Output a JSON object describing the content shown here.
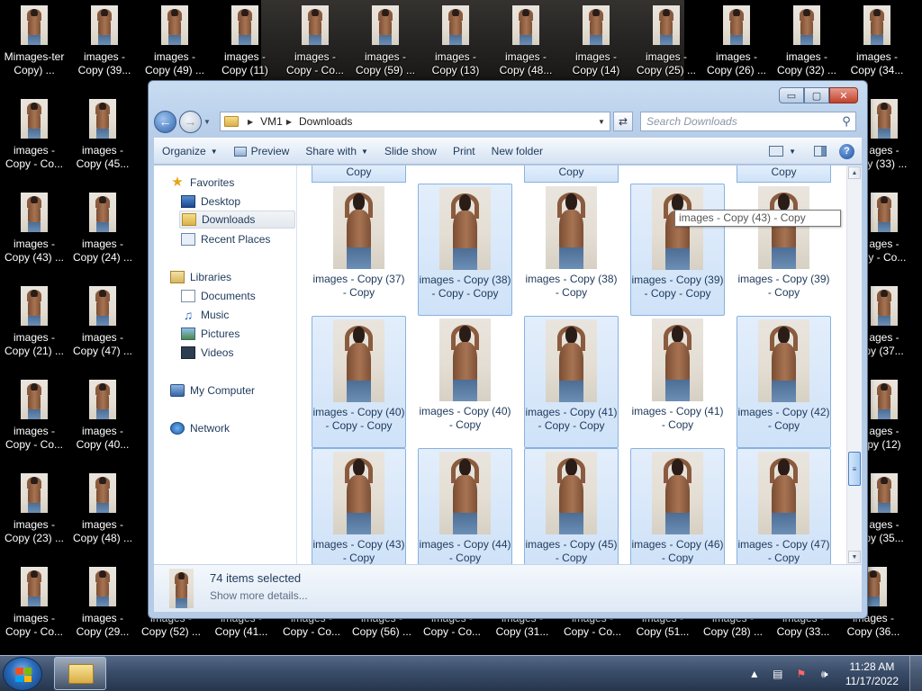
{
  "desktop": {
    "top_row": [
      {
        "line1": "Mimages-ter",
        "line2": "Copy) ..."
      },
      {
        "line1": "images -",
        "line2": "Copy (39..."
      },
      {
        "line1": "images -",
        "line2": "Copy (49) ..."
      },
      {
        "line1": "images -",
        "line2": "Copy (11)"
      },
      {
        "line1": "images -",
        "line2": "Copy - Co..."
      },
      {
        "line1": "images -",
        "line2": "Copy (59) ..."
      },
      {
        "line1": "images -",
        "line2": "Copy (13)"
      },
      {
        "line1": "images -",
        "line2": "Copy (48..."
      },
      {
        "line1": "images -",
        "line2": "Copy (14)"
      },
      {
        "line1": "images -",
        "line2": "Copy (25) ..."
      },
      {
        "line1": "images -",
        "line2": "Copy (26) ..."
      },
      {
        "line1": "images -",
        "line2": "Copy (32) ..."
      },
      {
        "line1": "images -",
        "line2": "Copy (34..."
      }
    ],
    "left_col1": [
      {
        "line1": "images -",
        "line2": "Copy - Co..."
      },
      {
        "line1": "images -",
        "line2": "Copy (43) ..."
      },
      {
        "line1": "images -",
        "line2": "Copy (21) ..."
      },
      {
        "line1": "images -",
        "line2": "Copy - Co..."
      },
      {
        "line1": "images -",
        "line2": "Copy (23) ..."
      },
      {
        "line1": "images -",
        "line2": "Copy - Co..."
      }
    ],
    "left_col2": [
      {
        "line1": "images -",
        "line2": "Copy (45..."
      },
      {
        "line1": "images -",
        "line2": "Copy (24) ..."
      },
      {
        "line1": "images -",
        "line2": "Copy (47) ..."
      },
      {
        "line1": "images -",
        "line2": "Copy (40..."
      },
      {
        "line1": "images -",
        "line2": "Copy (48) ..."
      },
      {
        "line1": "images -",
        "line2": "Copy (29..."
      }
    ],
    "right_col": [
      {
        "line1": "ages -",
        "line2": "py (33) ..."
      },
      {
        "line1": "ages -",
        "line2": "py - Co..."
      },
      {
        "line1": "ages -",
        "line2": "py (37..."
      },
      {
        "line1": "ages -",
        "line2": "py (12)"
      },
      {
        "line1": "ages -",
        "line2": "py (35..."
      }
    ],
    "bottom_row": [
      {
        "line1": "images -",
        "line2": "Copy (52) ..."
      },
      {
        "line1": "images -",
        "line2": "Copy (41..."
      },
      {
        "line1": "images -",
        "line2": "Copy - Co..."
      },
      {
        "line1": "images -",
        "line2": "Copy (56) ..."
      },
      {
        "line1": "images -",
        "line2": "Copy - Co..."
      },
      {
        "line1": "images -",
        "line2": "Copy (31..."
      },
      {
        "line1": "images -",
        "line2": "Copy - Co..."
      },
      {
        "line1": "images -",
        "line2": "Copy (51..."
      },
      {
        "line1": "images -",
        "line2": "Copy (28) ..."
      },
      {
        "line1": "images -",
        "line2": "Copy (33..."
      },
      {
        "line1": "images -",
        "line2": "Copy (36..."
      }
    ]
  },
  "window": {
    "caption_buttons": {
      "minimize": "▭",
      "maximize": "▢",
      "close": "✕"
    },
    "breadcrumb": [
      "VM1",
      "Downloads"
    ],
    "search_placeholder": "Search Downloads",
    "toolbar": {
      "organize": "Organize",
      "preview": "Preview",
      "share_with": "Share with",
      "slide_show": "Slide show",
      "print": "Print",
      "new_folder": "New folder"
    },
    "nav": {
      "favorites": "Favorites",
      "desktop": "Desktop",
      "downloads": "Downloads",
      "recent_places": "Recent Places",
      "libraries": "Libraries",
      "documents": "Documents",
      "music": "Music",
      "pictures": "Pictures",
      "videos": "Videos",
      "my_computer": "My Computer",
      "network": "Network"
    },
    "partial_top": [
      "Copy",
      "",
      "Copy",
      "",
      "Copy"
    ],
    "files": [
      {
        "name": "images - Copy (37) - Copy",
        "selected": false
      },
      {
        "name": "images - Copy (38) - Copy - Copy",
        "selected": true
      },
      {
        "name": "images - Copy (38) - Copy",
        "selected": false
      },
      {
        "name": "images - Copy (39) - Copy - Copy",
        "selected": true
      },
      {
        "name": "images - Copy (39) - Copy",
        "selected": false
      },
      {
        "name": "images - Copy (40) - Copy - Copy",
        "selected": true
      },
      {
        "name": "images - Copy (40) - Copy",
        "selected": false
      },
      {
        "name": "images - Copy (41) - Copy - Copy",
        "selected": true
      },
      {
        "name": "images - Copy (41) - Copy",
        "selected": false
      },
      {
        "name": "images - Copy (42) - Copy",
        "selected": true
      },
      {
        "name": "images - Copy (43) - Copy",
        "selected": true
      },
      {
        "name": "images - Copy (44) - Copy",
        "selected": true
      },
      {
        "name": "images - Copy (45) - Copy",
        "selected": true
      },
      {
        "name": "images - Copy (46) - Copy",
        "selected": true
      },
      {
        "name": "images - Copy (47) - Copy",
        "selected": true
      }
    ],
    "tooltip": "images - Copy (43) - Copy",
    "status": {
      "count": "74 items selected",
      "more": "Show more details..."
    }
  },
  "taskbar": {
    "time": "11:28 AM",
    "date": "11/17/2022"
  }
}
